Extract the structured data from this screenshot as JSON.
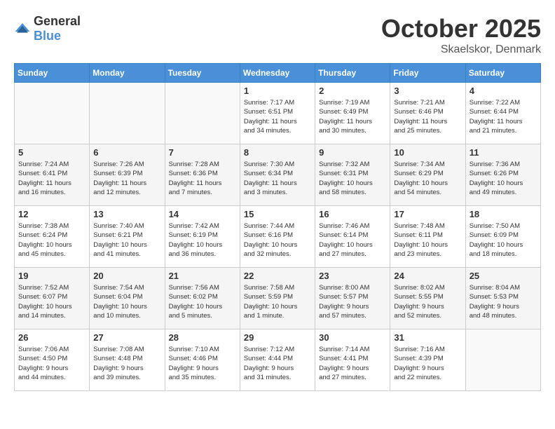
{
  "header": {
    "logo_general": "General",
    "logo_blue": "Blue",
    "month_title": "October 2025",
    "location": "Skaelskor, Denmark"
  },
  "days_of_week": [
    "Sunday",
    "Monday",
    "Tuesday",
    "Wednesday",
    "Thursday",
    "Friday",
    "Saturday"
  ],
  "weeks": [
    [
      {
        "day": "",
        "info": ""
      },
      {
        "day": "",
        "info": ""
      },
      {
        "day": "",
        "info": ""
      },
      {
        "day": "1",
        "info": "Sunrise: 7:17 AM\nSunset: 6:51 PM\nDaylight: 11 hours\nand 34 minutes."
      },
      {
        "day": "2",
        "info": "Sunrise: 7:19 AM\nSunset: 6:49 PM\nDaylight: 11 hours\nand 30 minutes."
      },
      {
        "day": "3",
        "info": "Sunrise: 7:21 AM\nSunset: 6:46 PM\nDaylight: 11 hours\nand 25 minutes."
      },
      {
        "day": "4",
        "info": "Sunrise: 7:22 AM\nSunset: 6:44 PM\nDaylight: 11 hours\nand 21 minutes."
      }
    ],
    [
      {
        "day": "5",
        "info": "Sunrise: 7:24 AM\nSunset: 6:41 PM\nDaylight: 11 hours\nand 16 minutes."
      },
      {
        "day": "6",
        "info": "Sunrise: 7:26 AM\nSunset: 6:39 PM\nDaylight: 11 hours\nand 12 minutes."
      },
      {
        "day": "7",
        "info": "Sunrise: 7:28 AM\nSunset: 6:36 PM\nDaylight: 11 hours\nand 7 minutes."
      },
      {
        "day": "8",
        "info": "Sunrise: 7:30 AM\nSunset: 6:34 PM\nDaylight: 11 hours\nand 3 minutes."
      },
      {
        "day": "9",
        "info": "Sunrise: 7:32 AM\nSunset: 6:31 PM\nDaylight: 10 hours\nand 58 minutes."
      },
      {
        "day": "10",
        "info": "Sunrise: 7:34 AM\nSunset: 6:29 PM\nDaylight: 10 hours\nand 54 minutes."
      },
      {
        "day": "11",
        "info": "Sunrise: 7:36 AM\nSunset: 6:26 PM\nDaylight: 10 hours\nand 49 minutes."
      }
    ],
    [
      {
        "day": "12",
        "info": "Sunrise: 7:38 AM\nSunset: 6:24 PM\nDaylight: 10 hours\nand 45 minutes."
      },
      {
        "day": "13",
        "info": "Sunrise: 7:40 AM\nSunset: 6:21 PM\nDaylight: 10 hours\nand 41 minutes."
      },
      {
        "day": "14",
        "info": "Sunrise: 7:42 AM\nSunset: 6:19 PM\nDaylight: 10 hours\nand 36 minutes."
      },
      {
        "day": "15",
        "info": "Sunrise: 7:44 AM\nSunset: 6:16 PM\nDaylight: 10 hours\nand 32 minutes."
      },
      {
        "day": "16",
        "info": "Sunrise: 7:46 AM\nSunset: 6:14 PM\nDaylight: 10 hours\nand 27 minutes."
      },
      {
        "day": "17",
        "info": "Sunrise: 7:48 AM\nSunset: 6:11 PM\nDaylight: 10 hours\nand 23 minutes."
      },
      {
        "day": "18",
        "info": "Sunrise: 7:50 AM\nSunset: 6:09 PM\nDaylight: 10 hours\nand 18 minutes."
      }
    ],
    [
      {
        "day": "19",
        "info": "Sunrise: 7:52 AM\nSunset: 6:07 PM\nDaylight: 10 hours\nand 14 minutes."
      },
      {
        "day": "20",
        "info": "Sunrise: 7:54 AM\nSunset: 6:04 PM\nDaylight: 10 hours\nand 10 minutes."
      },
      {
        "day": "21",
        "info": "Sunrise: 7:56 AM\nSunset: 6:02 PM\nDaylight: 10 hours\nand 5 minutes."
      },
      {
        "day": "22",
        "info": "Sunrise: 7:58 AM\nSunset: 5:59 PM\nDaylight: 10 hours\nand 1 minute."
      },
      {
        "day": "23",
        "info": "Sunrise: 8:00 AM\nSunset: 5:57 PM\nDaylight: 9 hours\nand 57 minutes."
      },
      {
        "day": "24",
        "info": "Sunrise: 8:02 AM\nSunset: 5:55 PM\nDaylight: 9 hours\nand 52 minutes."
      },
      {
        "day": "25",
        "info": "Sunrise: 8:04 AM\nSunset: 5:53 PM\nDaylight: 9 hours\nand 48 minutes."
      }
    ],
    [
      {
        "day": "26",
        "info": "Sunrise: 7:06 AM\nSunset: 4:50 PM\nDaylight: 9 hours\nand 44 minutes."
      },
      {
        "day": "27",
        "info": "Sunrise: 7:08 AM\nSunset: 4:48 PM\nDaylight: 9 hours\nand 39 minutes."
      },
      {
        "day": "28",
        "info": "Sunrise: 7:10 AM\nSunset: 4:46 PM\nDaylight: 9 hours\nand 35 minutes."
      },
      {
        "day": "29",
        "info": "Sunrise: 7:12 AM\nSunset: 4:44 PM\nDaylight: 9 hours\nand 31 minutes."
      },
      {
        "day": "30",
        "info": "Sunrise: 7:14 AM\nSunset: 4:41 PM\nDaylight: 9 hours\nand 27 minutes."
      },
      {
        "day": "31",
        "info": "Sunrise: 7:16 AM\nSunset: 4:39 PM\nDaylight: 9 hours\nand 22 minutes."
      },
      {
        "day": "",
        "info": ""
      }
    ]
  ]
}
